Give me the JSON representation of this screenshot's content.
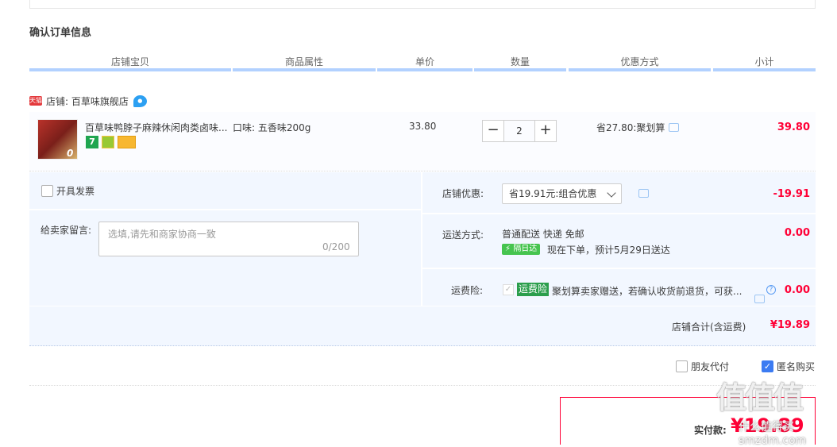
{
  "section_title": "确认订单信息",
  "columns": [
    "店铺宝贝",
    "商品属性",
    "单价",
    "数量",
    "优惠方式",
    "小计"
  ],
  "shop": {
    "badge": "天猫",
    "label": "店铺: 百草味旗舰店"
  },
  "item": {
    "thumb_text": "0",
    "title": "百草味鸭脖子麻辣休闲肉类卤味...",
    "tag1": "7",
    "attr": "口味: 五香味200g",
    "price": "33.80",
    "qty": "2",
    "minus": "−",
    "plus": "+",
    "promo": "省27.80:聚划算",
    "subtotal": "39.80"
  },
  "invoice": {
    "label": "开具发票"
  },
  "memo": {
    "label": "给卖家留言:",
    "placeholder": "选填,请先和商家协商一致",
    "count": "0/200"
  },
  "shop_discount": {
    "label": "店铺优惠:",
    "selected": "省19.91元:组合优惠",
    "value": "-19.91"
  },
  "shipping": {
    "label": "运送方式:",
    "method": "普通配送 快递 免邮",
    "badge": "隔日达",
    "eta": "现在下单，预计5月29日送达",
    "value": "0.00"
  },
  "insurance": {
    "label": "运费险:",
    "badge": "运费险",
    "text": "聚划算卖家赠送，若确认收货前退货，可获...",
    "value": "0.00"
  },
  "shop_total": {
    "label": "店铺合计(含运费)",
    "value": "¥19.89"
  },
  "friend_pay": {
    "label": "朋友代付"
  },
  "anonymous": {
    "label": "匿名购买"
  },
  "actual": {
    "label": "实付款:",
    "value": "¥19.89"
  },
  "watermark": {
    "text": "值值值",
    "url": "什么值得买 smzdm.com"
  },
  "colors": {
    "accent": "#ff0036",
    "header_bar": "#b2d1ff",
    "panel_bg": "#f2f7ff"
  }
}
